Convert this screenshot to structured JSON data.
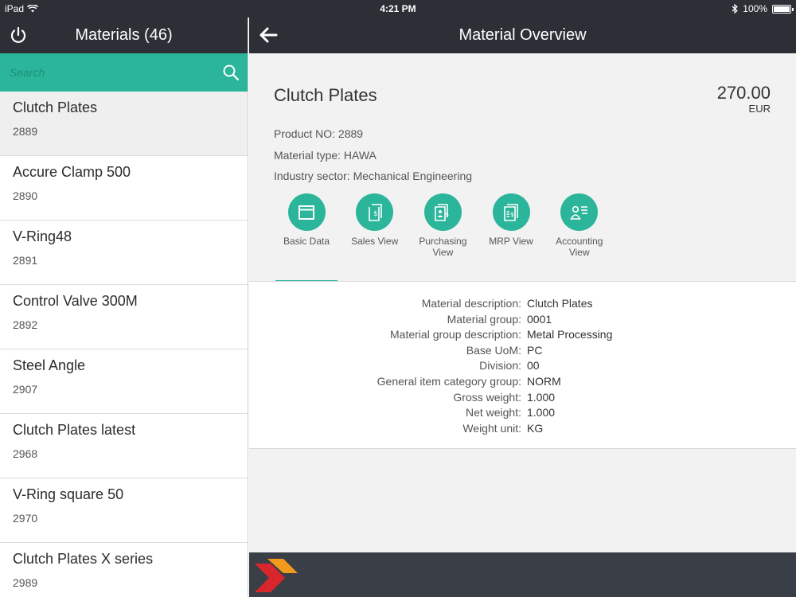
{
  "status_bar": {
    "device": "iPad",
    "time": "4:21 PM",
    "battery": "100%"
  },
  "left": {
    "title": "Materials (46)",
    "search_placeholder": "Search",
    "items": [
      {
        "name": "Clutch Plates",
        "number": "2889",
        "selected": true
      },
      {
        "name": "Accure Clamp 500",
        "number": "2890"
      },
      {
        "name": "V-Ring48",
        "number": "2891"
      },
      {
        "name": "Control Valve 300M",
        "number": "2892"
      },
      {
        "name": "Steel Angle",
        "number": "2907"
      },
      {
        "name": "Clutch Plates latest",
        "number": "2968"
      },
      {
        "name": "V-Ring square 50",
        "number": "2970"
      },
      {
        "name": "Clutch Plates X series",
        "number": "2989"
      }
    ]
  },
  "right": {
    "title": "Material Overview",
    "object": {
      "title": "Clutch Plates",
      "price": "270.00",
      "currency": "EUR",
      "attributes": [
        "Product NO: 2889",
        "Material type: HAWA",
        "Industry sector: Mechanical Engineering"
      ]
    },
    "tabs": [
      {
        "label": "Basic Data",
        "icon": "window-icon",
        "active": true
      },
      {
        "label": "Sales View",
        "icon": "document-dollar-icon"
      },
      {
        "label": "Purchasing View",
        "icon": "purchasing-document-icon"
      },
      {
        "label": "MRP View",
        "icon": "list-dollar-icon"
      },
      {
        "label": "Accounting View",
        "icon": "person-list-icon"
      }
    ],
    "details": [
      {
        "key": "Material description:",
        "value": "Clutch Plates"
      },
      {
        "key": "Material group:",
        "value": "0001"
      },
      {
        "key": "Material group description:",
        "value": "Metal Processing"
      },
      {
        "key": "Base UoM:",
        "value": "PC"
      },
      {
        "key": "Division:",
        "value": "00"
      },
      {
        "key": "General item category group:",
        "value": "NORM"
      },
      {
        "key": "Gross weight:",
        "value": "1.000"
      },
      {
        "key": "Net weight:",
        "value": "1.000"
      },
      {
        "key": "Weight unit:",
        "value": "KG"
      }
    ]
  },
  "colors": {
    "accent": "#2bb59a",
    "header": "#2c2f36",
    "footer": "#3a3f47",
    "logo_red": "#d9262c",
    "logo_orange": "#f39a1c"
  }
}
